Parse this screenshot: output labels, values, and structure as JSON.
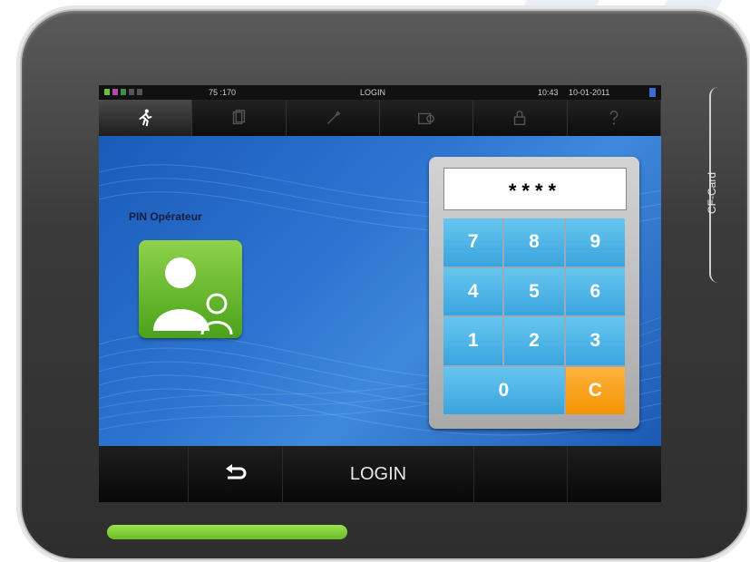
{
  "statusbar": {
    "counter": "75 :170",
    "title": "LOGIN",
    "time": "10:43",
    "date": "10-01-2011"
  },
  "tabs": [
    {
      "icon": "running-person-icon",
      "active": true
    },
    {
      "icon": "documents-icon",
      "active": false
    },
    {
      "icon": "wrench-icon",
      "active": false
    },
    {
      "icon": "program-folder-icon",
      "active": false
    },
    {
      "icon": "lock-icon",
      "active": false
    },
    {
      "icon": "help-icon",
      "active": false
    }
  ],
  "login": {
    "pin_label": "PIN Opérateur",
    "pin_value": "****"
  },
  "keypad": {
    "keys": [
      "7",
      "8",
      "9",
      "4",
      "5",
      "6",
      "1",
      "2",
      "3"
    ],
    "zero": "0",
    "clear": "C"
  },
  "bottombar": {
    "back_icon": "back-arrow-icon",
    "title": "LOGIN"
  },
  "device": {
    "cf_label": "CF-Card"
  },
  "colors": {
    "key_blue": "#4fb5e8",
    "key_orange": "#f5a020",
    "screen_blue": "#2a6dcc",
    "user_green": "#6cc02f",
    "led_green": "#8bd33f"
  }
}
